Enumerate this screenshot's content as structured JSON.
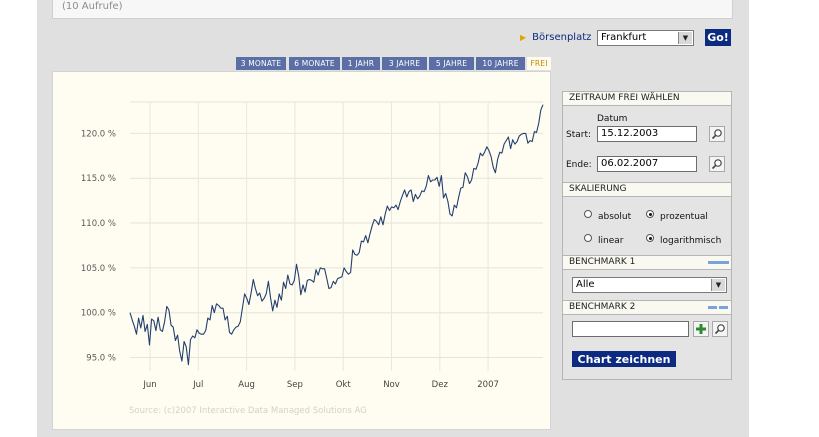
{
  "header": {
    "calls": "(10 Aufrufe)"
  },
  "exchange": {
    "label": "Börsenplatz",
    "value": "Frankfurt",
    "go": "Go!"
  },
  "tabs": [
    {
      "label": "3 MONATE"
    },
    {
      "label": "6 MONATE"
    },
    {
      "label": "1 JAHR"
    },
    {
      "label": "3 JAHRE"
    },
    {
      "label": "5 JAHRE"
    },
    {
      "label": "10 JAHRE"
    },
    {
      "label": "FREI"
    }
  ],
  "panel": {
    "period": {
      "header": "ZEITRAUM FREI WÄHLEN",
      "date_col": "Datum",
      "start_label": "Start:",
      "start_value": "15.12.2003",
      "end_label": "Ende:",
      "end_value": "06.02.2007"
    },
    "scaling": {
      "header": "SKALIERUNG",
      "absolut": "absolut",
      "prozentual": "prozentual",
      "linear": "linear",
      "logarithmisch": "logarithmisch",
      "selected_mode": "prozentual",
      "selected_scale": "logarithmisch"
    },
    "benchmark1": {
      "header": "BENCHMARK 1",
      "value": "Alle",
      "line_color": "#7aa3da"
    },
    "benchmark2": {
      "header": "BENCHMARK 2",
      "value": ""
    },
    "draw_button": "Chart zeichnen"
  },
  "colors": {
    "navy": "#0b2a80",
    "tab": "#5b6fa6",
    "line": "#233f6e"
  },
  "chart_data": {
    "type": "line",
    "source": "Source: (c)2007 Interactive Data Managed Solutions AG",
    "x_tick_labels": [
      "Jun",
      "Jul",
      "Aug",
      "Sep",
      "Okt",
      "Nov",
      "Dez",
      "2007"
    ],
    "y_tick_labels": [
      "95.0 %",
      "100.0 %",
      "105.0 %",
      "110.0 %",
      "115.0 %",
      "120.0 %"
    ],
    "y_tick_values": [
      95,
      100,
      105,
      110,
      115,
      120
    ],
    "ylim": [
      93.5,
      123.5
    ],
    "grid": true,
    "series": [
      {
        "values": [
          100.0,
          99.2,
          98.5,
          97.6,
          99.4,
          98.3,
          99.7,
          97.9,
          98.7,
          96.4,
          99.3,
          99.1,
          98.0,
          99.5,
          98.1,
          97.9,
          99.0,
          100.7,
          100.3,
          98.6,
          98.4,
          96.9,
          97.5,
          95.7,
          94.6,
          96.8,
          96.2,
          94.2,
          97.0,
          97.4,
          97.2,
          98.1,
          97.7,
          97.6,
          97.6,
          98.0,
          99.4,
          99.2,
          100.8,
          100.0,
          101.0,
          100.8,
          100.5,
          100.5,
          99.2,
          99.6,
          97.8,
          97.6,
          98.1,
          98.4,
          98.5,
          99.0,
          100.5,
          102.1,
          101.6,
          100.9,
          102.2,
          103.7,
          102.7,
          101.9,
          102.2,
          101.3,
          101.6,
          102.1,
          103.5,
          101.7,
          100.2,
          101.4,
          100.6,
          102.1,
          101.4,
          103.4,
          102.7,
          104.2,
          103.2,
          103.1,
          103.6,
          105.4,
          104.1,
          102.0,
          103.1,
          102.3,
          103.6,
          103.7,
          103.6,
          103.4,
          104.8,
          104.2,
          105.0,
          104.9,
          104.9,
          103.8,
          102.7,
          102.8,
          103.5,
          103.2,
          103.8,
          103.9,
          104.0,
          105.0,
          104.6,
          104.3,
          104.5,
          107.0,
          106.5,
          106.4,
          106.7,
          108.0,
          107.9,
          108.6,
          107.8,
          108.8,
          109.7,
          110.4,
          110.2,
          109.8,
          110.7,
          109.8,
          111.0,
          111.9,
          111.4,
          111.8,
          111.7,
          112.0,
          111.5,
          112.4,
          113.1,
          113.7,
          112.9,
          113.5,
          113.7,
          112.4,
          113.2,
          112.7,
          113.0,
          113.6,
          113.5,
          114.1,
          115.3,
          114.6,
          114.8,
          114.8,
          115.1,
          114.1,
          115.3,
          112.8,
          113.3,
          112.4,
          111.0,
          110.8,
          112.0,
          111.7,
          112.9,
          113.9,
          114.0,
          115.6,
          115.2,
          114.4,
          114.8,
          116.1,
          116.0,
          116.7,
          117.8,
          117.5,
          117.9,
          118.5,
          118.1,
          117.4,
          116.2,
          115.6,
          117.1,
          117.9,
          117.8,
          118.8,
          119.2,
          119.6,
          118.3,
          119.3,
          118.8,
          119.1,
          119.7,
          119.9,
          120.0,
          120.0,
          118.9,
          119.2,
          119.1,
          120.2,
          120.1,
          121.1,
          122.6,
          123.2
        ]
      }
    ]
  }
}
